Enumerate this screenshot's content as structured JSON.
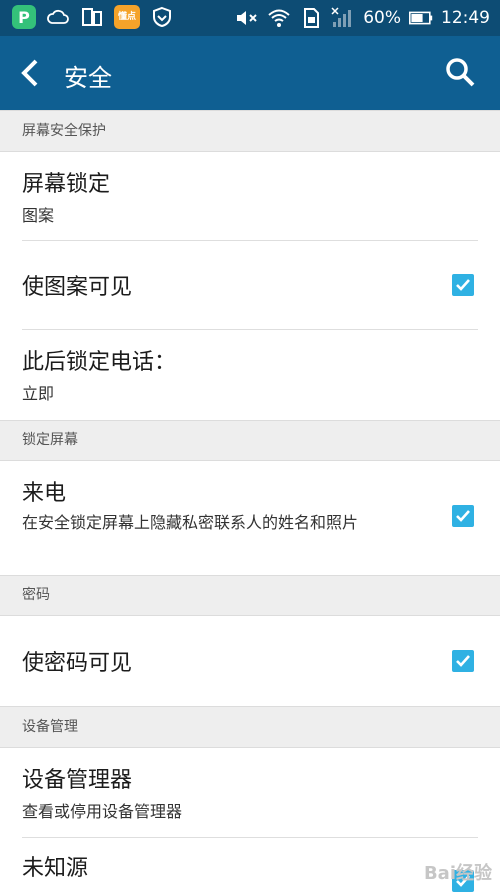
{
  "statusbar": {
    "battery": "60%",
    "time": "12:49",
    "app_icon_2_text": "懂点"
  },
  "appbar": {
    "title": "安全"
  },
  "sections": {
    "screen_security": {
      "header": "屏幕安全保护",
      "screen_lock": {
        "title": "屏幕锁定",
        "value": "图案"
      },
      "pattern_visible": {
        "title": "使图案可见",
        "checked": true
      },
      "lock_after": {
        "title": "此后锁定电话：",
        "value": "立即"
      }
    },
    "lock_screen": {
      "header": "锁定屏幕",
      "incoming_call": {
        "title": "来电",
        "summary": "在安全锁定屏幕上隐藏私密联系人的姓名和照片",
        "checked": true
      }
    },
    "password": {
      "header": "密码",
      "password_visible": {
        "title": "使密码可见",
        "checked": true
      }
    },
    "device_admin": {
      "header": "设备管理",
      "device_admins": {
        "title": "设备管理器",
        "summary": "查看或停用设备管理器"
      },
      "unknown_sources": {
        "title": "未知源",
        "checked": true
      }
    }
  },
  "watermark": "Bai经验"
}
